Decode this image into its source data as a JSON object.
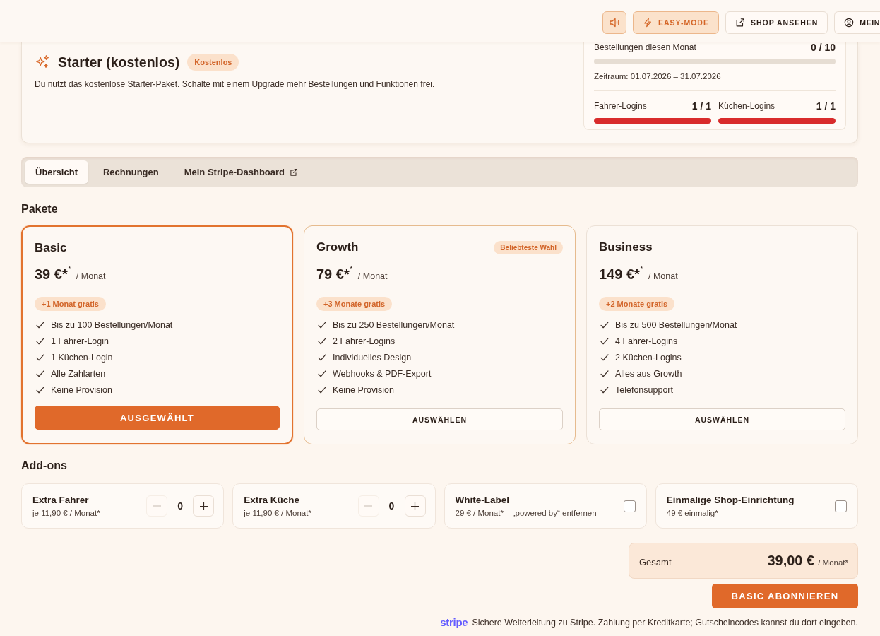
{
  "header": {
    "buttons": [
      {
        "kind": "icon",
        "active": true
      },
      {
        "kind": "labeled",
        "label": "EASY-MODE",
        "active": true
      },
      {
        "kind": "labeled",
        "label": "SHOP ANSEHEN",
        "active": false
      },
      {
        "kind": "labeled",
        "label": "MEIN",
        "active": false
      }
    ]
  },
  "plan_status": {
    "title": "Starter (kostenlos)",
    "badge": "Kostenlos",
    "description": "Du nutzt das kostenlose Starter-Paket. Schalte mit einem Upgrade mehr Bestellungen und Funktionen frei.",
    "usage": {
      "orders": {
        "label": "Bestellungen diesen Monat",
        "reading": "0 / 10",
        "level": 0
      },
      "period": "Zeitraum: 01.07.2026 – 31.07.2026",
      "logins": [
        {
          "label": "Fahrer-Logins",
          "reading": "1 / 1",
          "level": 1
        },
        {
          "label": "Küchen-Logins",
          "reading": "1 / 1",
          "level": 1
        }
      ]
    }
  },
  "tabs": [
    {
      "label": "Übersicht",
      "selected": true,
      "external": false
    },
    {
      "label": "Rechnungen",
      "selected": false,
      "external": false
    },
    {
      "label": "Mein Stripe-Dashboard",
      "selected": false,
      "external": true
    }
  ],
  "plans": {
    "heading": "Pakete",
    "items": [
      {
        "name": "Basic",
        "price": "39 €*",
        "price_note": "*",
        "period": "/ Monat",
        "bonus": "+1 Monat gratis",
        "features": [
          "Bis zu 100 Bestellungen/Monat",
          "1 Fahrer-Login",
          "1 Küchen-Login",
          "Alle Zahlarten",
          "Keine Provision"
        ],
        "button": "AUSGEWÄHLT",
        "selected": true,
        "popular": false
      },
      {
        "name": "Growth",
        "badge": "Beliebteste Wahl",
        "price": "79 €*",
        "price_note": "*",
        "period": "/ Monat",
        "bonus": "+3 Monate gratis",
        "features": [
          "Bis zu 250 Bestellungen/Monat",
          "2 Fahrer-Logins",
          "Individuelles Design",
          "Webhooks & PDF-Export",
          "Keine Provision"
        ],
        "button": "AUSWÄHLEN",
        "selected": false,
        "popular": true
      },
      {
        "name": "Business",
        "price": "149 €*",
        "price_note": "*",
        "period": "/ Monat",
        "bonus": "+2 Monate gratis",
        "features": [
          "Bis zu 500 Bestellungen/Monat",
          "4 Fahrer-Logins",
          "2 Küchen-Logins",
          "Alles aus Growth",
          "Telefonsupport"
        ],
        "button": "AUSWÄHLEN",
        "selected": false,
        "popular": false
      }
    ]
  },
  "addons": {
    "heading": "Add-ons",
    "items": [
      {
        "kind": "counter",
        "name": "Extra Fahrer",
        "price": "je 11,90 € / Monat*",
        "value": "0",
        "decrement_disabled": true
      },
      {
        "kind": "counter",
        "name": "Extra Küche",
        "price": "je 11,90 € / Monat*",
        "value": "0",
        "decrement_disabled": true
      },
      {
        "kind": "checkbox",
        "name": "White-Label",
        "price": "29 € / Monat* – „powered by“ entfernen",
        "checked": false
      },
      {
        "kind": "checkbox",
        "name": "Einmalige Shop-Einrichtung",
        "price": "49 € einmalig*",
        "checked": false
      }
    ]
  },
  "total": {
    "label": "Gesamt",
    "amount": "39,00 €",
    "unit": "/ Monat*"
  },
  "subscribe_button": "BASIC ABONNIEREN",
  "footer": {
    "logo": "stripe",
    "note": "Sichere Weiterleitung zu Stripe. Zahlung per Kreditkarte; Gutscheincodes kannst du dort eingeben."
  }
}
